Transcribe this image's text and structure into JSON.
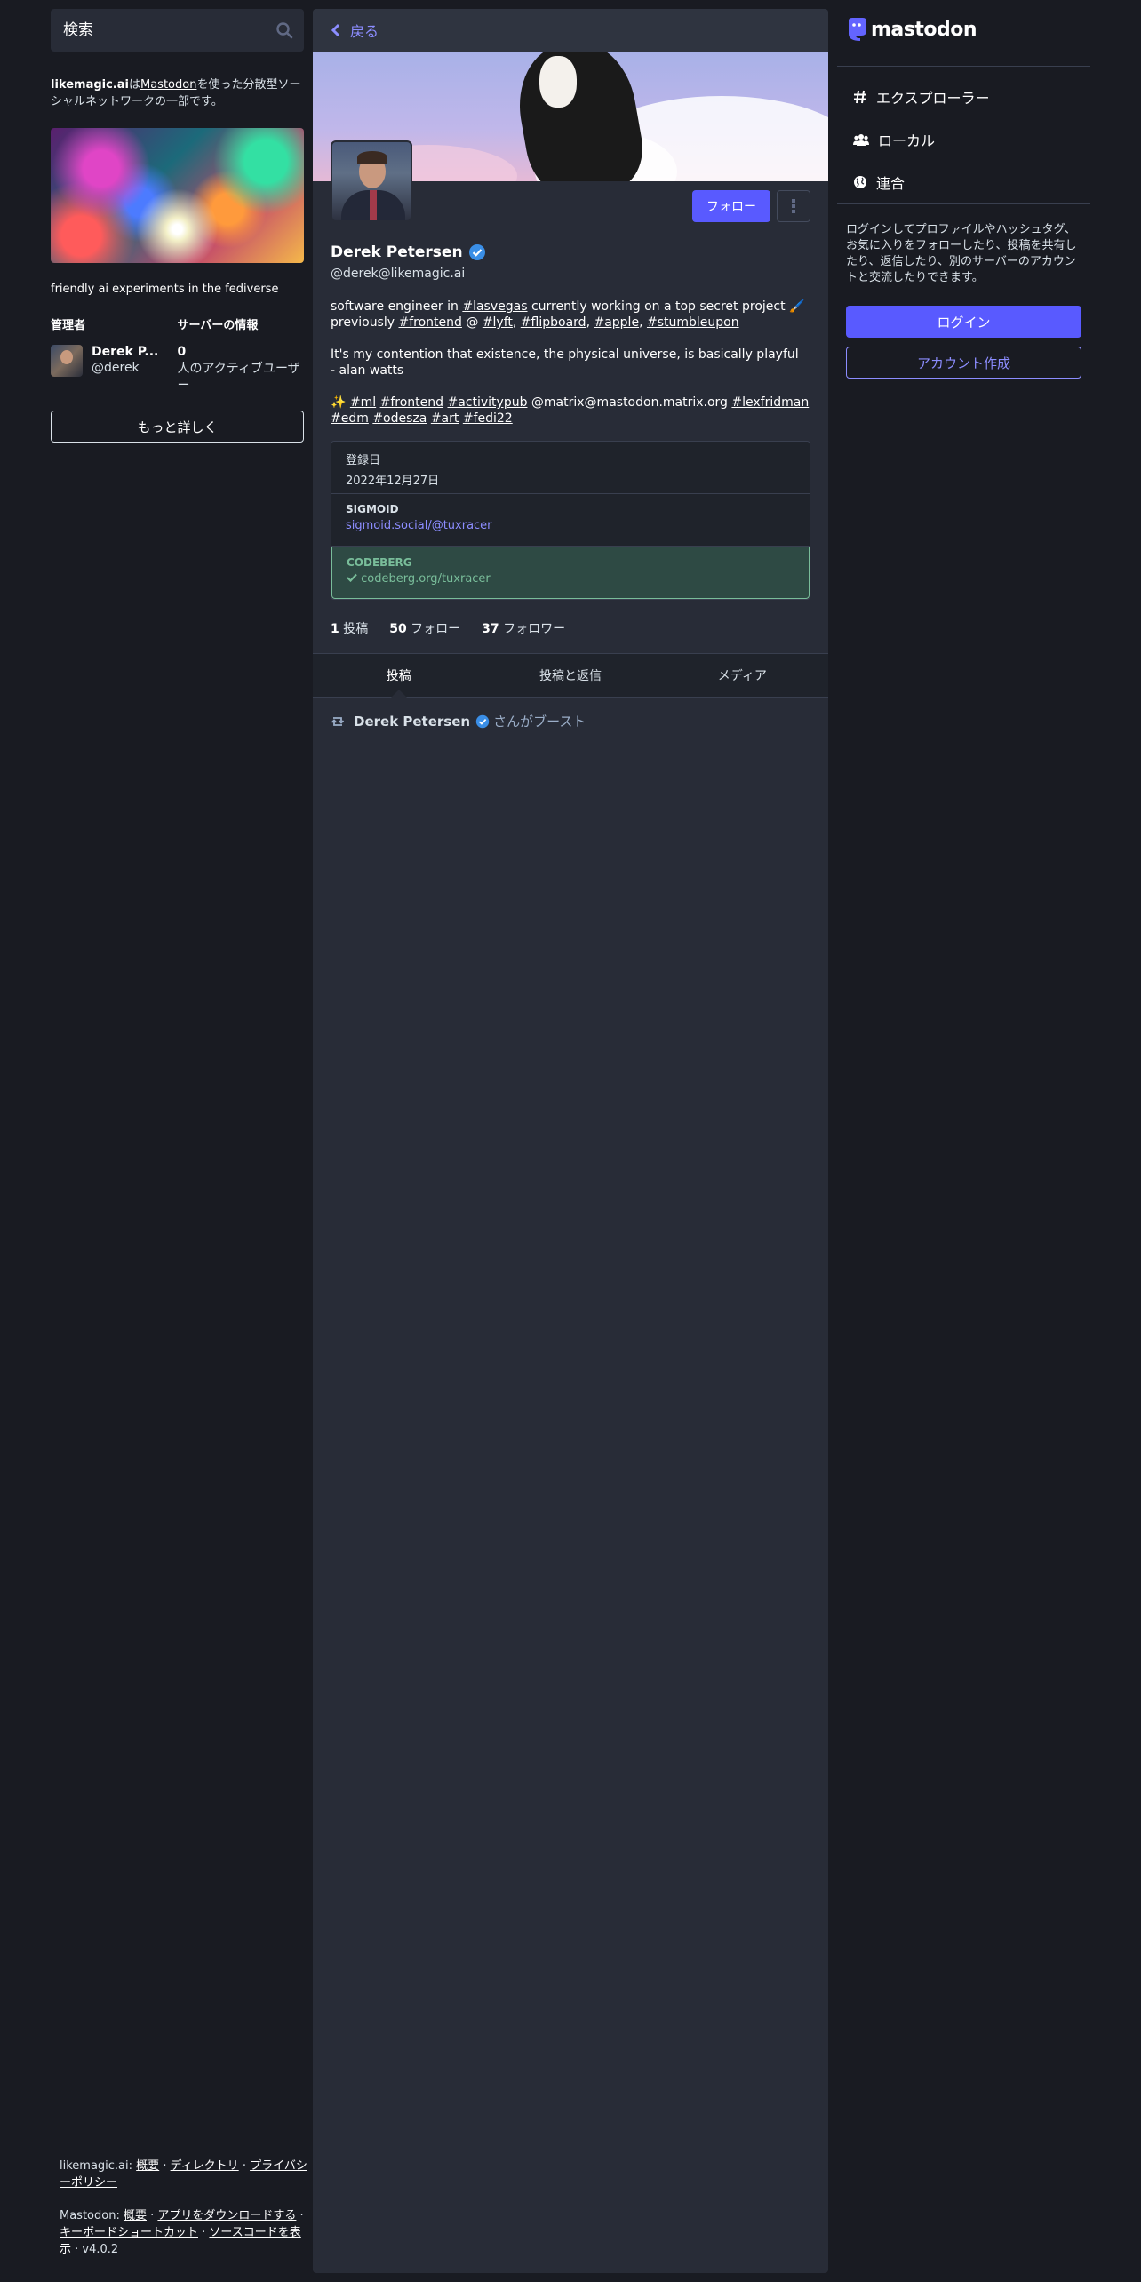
{
  "search": {
    "placeholder": "検索"
  },
  "about": {
    "domain": "likemagic.ai",
    "middle": "は",
    "mastodon_link": "Mastodon",
    "suffix": "を使った分散型ソーシャルネットワークの一部です。"
  },
  "server": {
    "description": "friendly ai experiments in the fediverse",
    "admin_heading": "管理者",
    "info_heading": "サーバーの情報",
    "admin_name": "Derek P...",
    "admin_handle": "@derek",
    "active_count": "0",
    "active_label": "人のアクティブユーザー",
    "more_label": "もっと詳しく"
  },
  "footer": {
    "line1_prefix": "likemagic.ai:",
    "line1_links": [
      "概要",
      "ディレクトリ",
      "プライバシーポリシー"
    ],
    "line2_prefix": "Mastodon:",
    "line2_links": [
      "概要",
      "アプリをダウンロードする",
      "キーボードショートカット",
      "ソースコードを表示"
    ],
    "version": "v4.0.2"
  },
  "header": {
    "back_label": "戻る"
  },
  "profile": {
    "display_name": "Derek Petersen",
    "acct": "@derek@likemagic.ai",
    "follow_label": "フォロー",
    "bio": {
      "p1_a": "software engineer in ",
      "p1_tag1": "#lasvegas",
      "p1_b": " currently working on a top secret project 🖌️ previously ",
      "p1_tag2": "#frontend",
      "p1_c": " @ ",
      "p1_tag3": "#lyft",
      "p1_tag4": "#flipboard",
      "p1_tag5": "#apple",
      "p1_tag6": "#stumbleupon",
      "p2_line1": "It's my contention that existence, the physical universe, is basically playful",
      "p2_line2": "- alan watts",
      "p3_emoji": "✨",
      "p3_tags": [
        "#ml",
        "#frontend",
        "#activitypub"
      ],
      "p3_mention": "@matrix@mastodon.matrix.org",
      "p3_tags2": [
        "#lexfridman",
        "#edm",
        "#odesza",
        "#art",
        "#fedi22"
      ]
    },
    "fields": [
      {
        "label": "登録日",
        "value": "2022年12月27日"
      },
      {
        "label": "SIGMOID",
        "value": "sigmoid.social/@tuxracer"
      },
      {
        "label": "CODEBERG",
        "value": "codeberg.org/tuxracer"
      }
    ],
    "counts": {
      "posts_num": "1",
      "posts_label": "投稿",
      "following_num": "50",
      "following_label": "フォロー",
      "followers_num": "37",
      "followers_label": "フォロワー"
    },
    "tabs": [
      "投稿",
      "投稿と返信",
      "メディア"
    ],
    "boost": {
      "name": "Derek Petersen",
      "suffix": "さんがブースト"
    }
  },
  "right": {
    "logo_text": "mastodon",
    "nav": [
      "エクスプローラー",
      "ローカル",
      "連合"
    ],
    "signin_text": "ログインしてプロファイルやハッシュタグ、お気に入りをフォローしたり、投稿を共有したり、返信したり、別のサーバーのアカウントと交流したりできます。",
    "login_label": "ログイン",
    "signup_label": "アカウント作成"
  },
  "colors": {
    "accent": "#595aff",
    "link": "#8c8dff",
    "verified": "#79bd9a",
    "bg": "#191b22",
    "panel": "#282c37"
  }
}
